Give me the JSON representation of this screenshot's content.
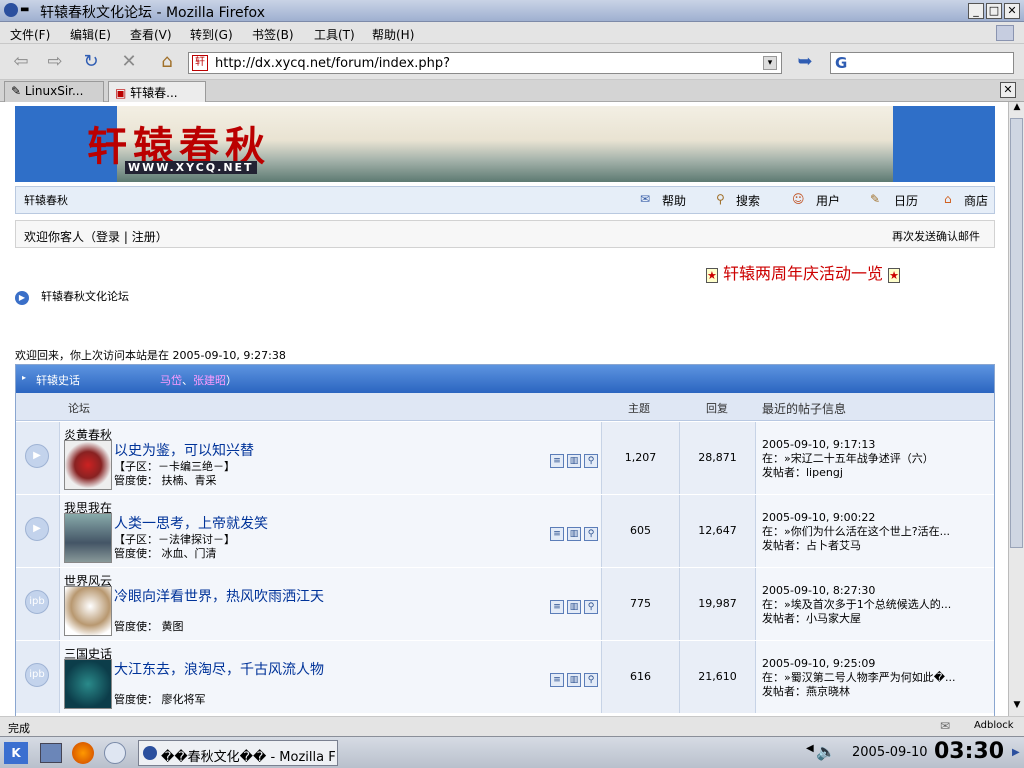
{
  "window": {
    "title": "轩辕春秋文化论坛 - Mozilla Firefox",
    "controls": {
      "minimize": "_",
      "maximize": "□",
      "close": "✕"
    }
  },
  "menu": {
    "items": [
      "文件(F)",
      "编辑(E)",
      "查看(V)",
      "转到(G)",
      "书签(B)",
      "工具(T)",
      "帮助(H)"
    ]
  },
  "toolbar": {
    "url": "http://dx.xycq.net/forum/index.php?",
    "search_engine": "G"
  },
  "tabs": [
    {
      "label": "LinuxSir..."
    },
    {
      "label": "轩辕春..."
    }
  ],
  "site": {
    "banner_title": "轩辕春秋",
    "banner_url": "WWW.XYCQ.NET",
    "brand_link": "轩辕春秋",
    "nav": {
      "help": "帮助",
      "search": "搜索",
      "users": "用户",
      "calendar": "日历",
      "shop": "商店"
    },
    "welcome": {
      "greeting": "欢迎你客人（",
      "login": "登录",
      "sep": "|",
      "register": "注册",
      "close": "）",
      "resend": "再次发送确认邮件"
    },
    "anniversary": "轩辕两周年庆活动一览",
    "breadcrumb": "轩辕春秋文化论坛",
    "last_visit": "欢迎回来，你上次访问本站是在 2005-09-10, 9:27:38"
  },
  "category": {
    "name": "轩辕史话",
    "moderators": [
      "马岱",
      "张建昭"
    ],
    "moderator_sep": "、",
    "moderator_close": "）",
    "columns": {
      "forum": "论坛",
      "topics": "主题",
      "replies": "回复",
      "last_post": "最近的帖子信息"
    }
  },
  "forums": [
    {
      "name": "炎黄春秋",
      "desc": "以史为鉴，可以知兴替",
      "sub": "【子区：－卡编三绝－】",
      "mod_label": "管度使：",
      "mods": "扶楠、青采",
      "topics": "1,207",
      "replies": "28,871",
      "last_time": "2005-09-10, 9:17:13",
      "last_title": "在：»宋辽二十五年战争述评（六）",
      "last_author": "发帖者：lipengj",
      "status": "▶"
    },
    {
      "name": "我思我在",
      "desc": "人类一思考，上帝就发笑",
      "sub": "【子区：－法律探讨－】",
      "mod_label": "管度使：",
      "mods": "冰血、门清",
      "topics": "605",
      "replies": "12,647",
      "last_time": "2005-09-10, 9:00:22",
      "last_title": "在：»你们为什么活在这个世上?活在...",
      "last_author": "发帖者：占卜者艾马",
      "status": "▶"
    },
    {
      "name": "世界风云",
      "desc": "冷眼向洋看世界，热风吹雨洒江天",
      "sub": "",
      "mod_label": "管度使：",
      "mods": "黄图",
      "topics": "775",
      "replies": "19,987",
      "last_time": "2005-09-10, 8:27:30",
      "last_title": "在：»埃及首次多于1个总统候选人的...",
      "last_author": "发帖者：小马家大屋",
      "status": "ipb"
    },
    {
      "name": "三国史话",
      "desc": "大江东去，浪淘尽，千古风流人物",
      "sub": "",
      "mod_label": "管度使：",
      "mods": "廖化将军",
      "topics": "616",
      "replies": "21,610",
      "last_time": "2005-09-10, 9:25:09",
      "last_title": "在：»蜀汉第二号人物李严为何如此�...",
      "last_author": "发帖者：燕京晓林",
      "status": "ipb"
    }
  ],
  "statusbar": {
    "text": "完成",
    "adblock": "Adblock"
  },
  "taskbar": {
    "window_label": "��春秋文化�� - Mozilla Fir",
    "date": "2005-09-10",
    "time": "03:30"
  }
}
